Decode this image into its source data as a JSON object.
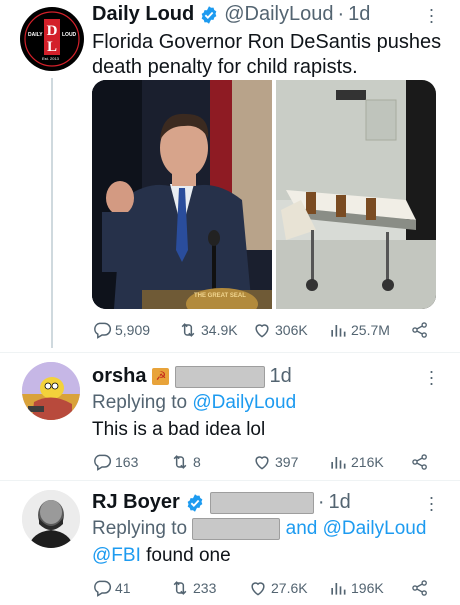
{
  "tweet_main": {
    "name": "Daily Loud",
    "handle": "@DailyLoud",
    "dot": "·",
    "time": "1d",
    "text_line1": "Florida Governor Ron DeSantis pushes",
    "text_line2": "death penalty for child rapists.",
    "avatar": {
      "word_left": "DAILY",
      "word_right": "LOUD",
      "est": "Est. 2013",
      "monogram": "DL"
    },
    "podium_text": "THE GREAT SEAL",
    "stats": {
      "replies": "5,909",
      "retweets": "34.9K",
      "likes": "306K",
      "views": "25.7M"
    }
  },
  "tweet_reply1": {
    "name": "orsha",
    "time": "1d",
    "replying_prefix": "Replying to",
    "replying_handle": "@DailyLoud",
    "text": "This is a bad idea lol",
    "stats": {
      "replies": "163",
      "retweets": "8",
      "likes": "397",
      "views": "216K"
    }
  },
  "tweet_reply2": {
    "name": "RJ Boyer",
    "dot": "·",
    "time": "1d",
    "replying_prefix": "Replying to",
    "replying_suffix": "and @DailyLoud",
    "mention": "@FBI",
    "text_rest": "found one",
    "stats": {
      "replies": "41",
      "retweets": "233",
      "likes": "27.6K",
      "views": "196K"
    }
  },
  "colors": {
    "link": "#1d9bf0",
    "muted": "#536471",
    "verified": "#1d9bf0",
    "text": "#0f1419",
    "brand_red": "#d3202a"
  }
}
